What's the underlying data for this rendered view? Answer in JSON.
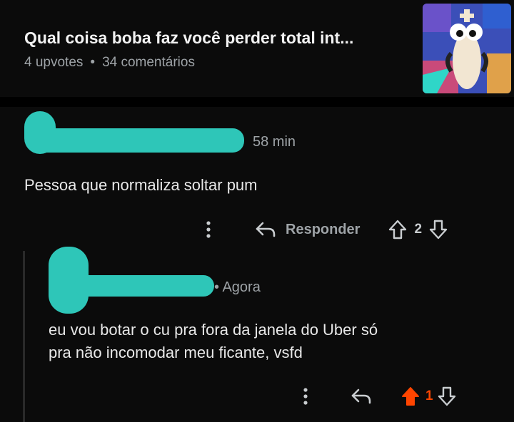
{
  "post": {
    "title": "Qual coisa boba faz você perder total int...",
    "upvotes": "4 upvotes",
    "separator": "•",
    "comments": "34 comentários",
    "thumbnail_icon": "game-thumbnail-icon"
  },
  "comment1": {
    "timestamp": "58 min",
    "text": "Pessoa que normaliza soltar pum",
    "reply_label": "Responder",
    "votes": "2"
  },
  "comment2": {
    "timestamp": "• Agora",
    "text_line1": "eu vou botar o cu pra fora da janela do Uber só",
    "text_line2": "pra não incomodar meu ficante, vsfd",
    "votes": "1"
  },
  "colors": {
    "background": "#0b0b0b",
    "redaction": "#2ec6b8",
    "upvote_active": "#ff4500",
    "muted": "#9ea3a7"
  }
}
